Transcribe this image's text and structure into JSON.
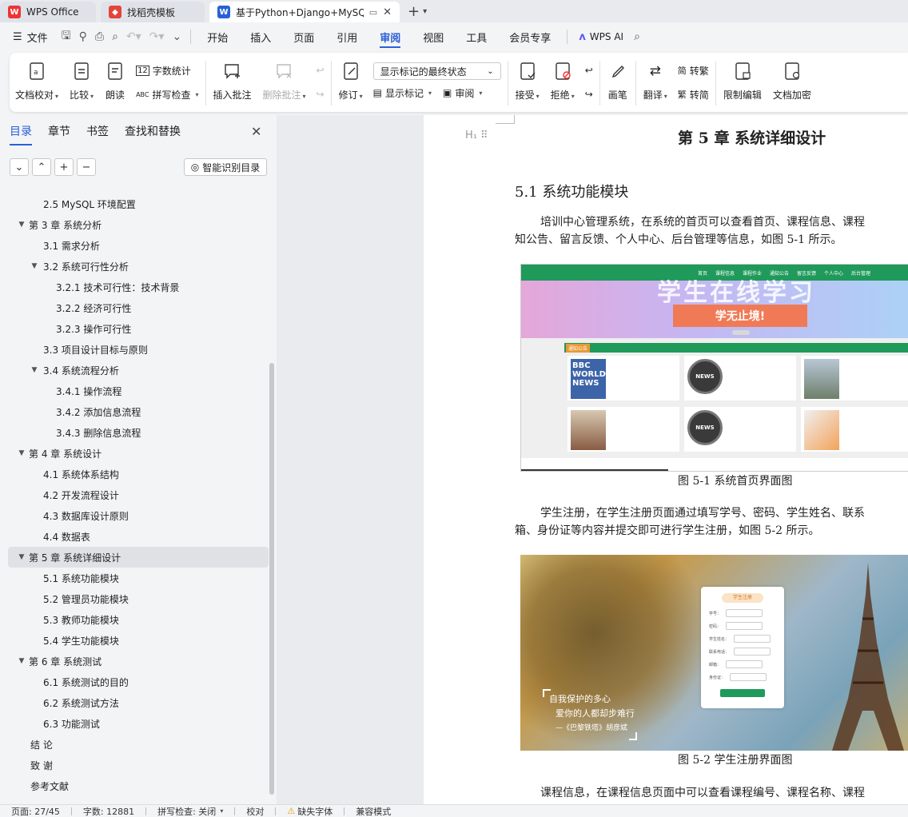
{
  "titlebar": {
    "tabs": [
      {
        "label": "WPS Office"
      },
      {
        "label": "找稻壳模板"
      },
      {
        "label": "基于Python+Django+MySQL"
      }
    ]
  },
  "menubar": {
    "file_label": "文件",
    "items": [
      "开始",
      "插入",
      "页面",
      "引用",
      "审阅",
      "视图",
      "工具",
      "会员专享"
    ],
    "active": "审阅",
    "wps_ai": "WPS AI"
  },
  "ribbon": {
    "doc_proof": "文档校对",
    "compare": "比较",
    "read_aloud": "朗读",
    "word_count": "字数统计",
    "spell_check": "拼写检查",
    "insert_comment": "插入批注",
    "delete_comment": "删除批注",
    "revise": "修订",
    "markup_state": "显示标记的最终状态",
    "show_markup": "显示标记",
    "review": "审阅",
    "accept": "接受",
    "reject": "拒绝",
    "pen": "画笔",
    "translate": "翻译",
    "to_traditional": "转繁",
    "to_simplified": "转简",
    "restrict_edit": "限制编辑",
    "doc_encrypt": "文档加密"
  },
  "sidebar": {
    "tabs": [
      "目录",
      "章节",
      "书签",
      "查找和替换"
    ],
    "active_tab": "目录",
    "smart_toc": "智能识别目录",
    "toc": [
      {
        "text": "2.5 MySQL 环境配置",
        "level": 2
      },
      {
        "text": "第 3 章  系统分析",
        "level": 1
      },
      {
        "text": "3.1  需求分析",
        "level": 2
      },
      {
        "text": "3.2  系统可行性分析",
        "level": 2
      },
      {
        "text": "3.2.1 技术可行性：技术背景",
        "level": 3
      },
      {
        "text": "3.2.2 经济可行性",
        "level": 3
      },
      {
        "text": "3.2.3 操作可行性",
        "level": 3
      },
      {
        "text": "3.3  项目设计目标与原则",
        "level": 2
      },
      {
        "text": "3.4 系统流程分析",
        "level": 2
      },
      {
        "text": "3.4.1 操作流程",
        "level": 3
      },
      {
        "text": "3.4.2 添加信息流程",
        "level": 3
      },
      {
        "text": "3.4.3 删除信息流程",
        "level": 3
      },
      {
        "text": "第 4 章  系统设计",
        "level": 1
      },
      {
        "text": "4.1  系统体系结构",
        "level": 2
      },
      {
        "text": "4.2 开发流程设计",
        "level": 2
      },
      {
        "text": "4.3  数据库设计原则",
        "level": 2
      },
      {
        "text": "4.4  数据表",
        "level": 2
      },
      {
        "text": "第 5 章  系统详细设计",
        "level": 1
      },
      {
        "text": "5.1 系统功能模块",
        "level": 2
      },
      {
        "text": "5.2 管理员功能模块",
        "level": 2
      },
      {
        "text": "5.3 教师功能模块",
        "level": 2
      },
      {
        "text": "5.4 学生功能模块",
        "level": 2
      },
      {
        "text": "第 6 章    系统测试",
        "level": 1
      },
      {
        "text": "6.1 系统测试的目的",
        "level": 2
      },
      {
        "text": "6.2 系统测试方法",
        "level": 2
      },
      {
        "text": "6.3 功能测试",
        "level": 2
      },
      {
        "text": "结    论",
        "level": 1
      },
      {
        "text": "致    谢",
        "level": 1
      },
      {
        "text": "参考文献",
        "level": 1
      }
    ]
  },
  "document": {
    "chapter_title": "第 5 章  系统详细设计",
    "section_title": "5.1 系统功能模块",
    "para1_line1": "培训中心管理系统，在系统的首页可以查看首页、课程信息、课程",
    "para1_line2": "知公告、留言反馈、个人中心、后台管理等信息，如图 5-1 所示。",
    "fig1_caption": "图 5-1 系统首页界面图",
    "para2_line1": "学生注册，在学生注册页面通过填写学号、密码、学生姓名、联系",
    "para2_line2": "箱、身份证等内容并提交即可进行学生注册，如图 5-2 所示。",
    "fig2_caption": "图 5-2 学生注册界面图",
    "para3_line1": "课程信息，在课程信息页面中可以查看课程编号、课程名称、课程",
    "fig1": {
      "nav": [
        "首页",
        "课程信息",
        "课程作业",
        "通知公告",
        "留言反馈",
        "个人中心",
        "后台管理"
      ],
      "banner_text": "学生在线学习",
      "slogan": "学无止境!",
      "notice": "通知公告",
      "bbc": "BBC WORLD NEWS",
      "news": "NEWS"
    },
    "fig2": {
      "form_title": "学生注册",
      "fields": [
        "学号：",
        "密码：",
        "学生姓名：",
        "联系电话：",
        "邮箱：",
        "身份证："
      ],
      "quote_line1": "自我保护的多心",
      "quote_line2": "爱你的人都却步难行",
      "quote_line3": "—《巴黎铁塔》胡彦斌"
    }
  },
  "statusbar": {
    "page": "页面: 27/45",
    "words": "字数: 12881",
    "spell": "拼写检查: 关闭",
    "proof": "校对",
    "missing_font": "缺失字体",
    "compat": "兼容模式"
  }
}
